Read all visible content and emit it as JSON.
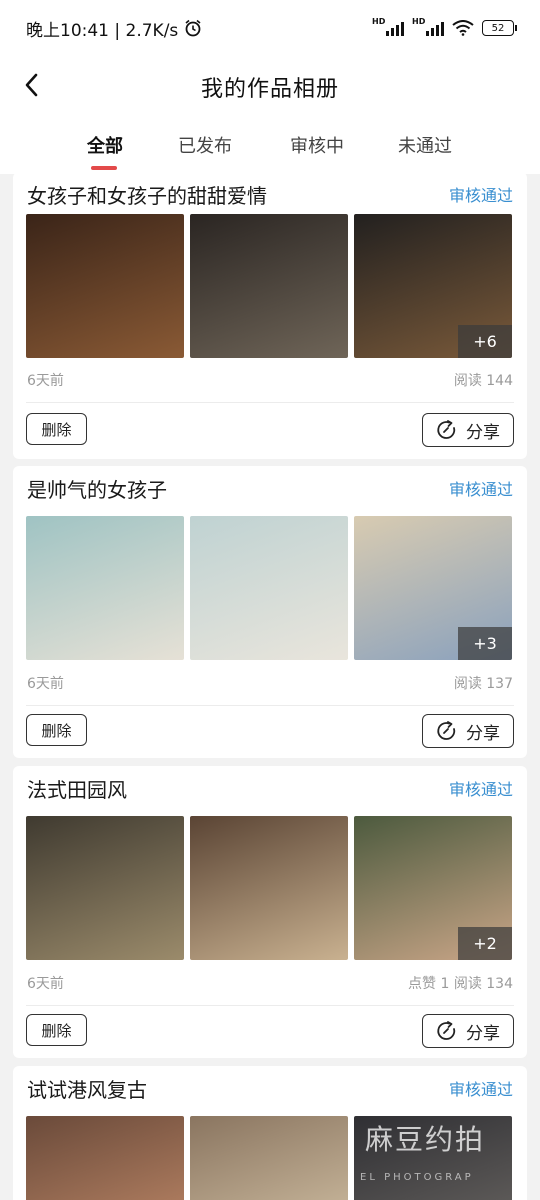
{
  "status_bar": {
    "time_speed": "晚上10:41 | 2.7K/s",
    "battery": "52",
    "signal_label": "HD",
    "icons": [
      "alarm-icon",
      "signal-icon",
      "wifi-icon",
      "battery-icon"
    ]
  },
  "header": {
    "title": "我的作品相册",
    "back_icon": "chevron-left-icon"
  },
  "tabs": [
    {
      "label": "全部",
      "active": true
    },
    {
      "label": "已发布",
      "active": false
    },
    {
      "label": "审核中",
      "active": false
    },
    {
      "label": "未通过",
      "active": false
    }
  ],
  "colors": {
    "accent": "#e34a4a",
    "status_link": "#3a8fd0",
    "page_bg": "#f2f2f2"
  },
  "albums": [
    {
      "title": "女孩子和女孩子的甜甜爱情",
      "status": "审核通过",
      "more_count": "+6",
      "time": "6天前",
      "stats": "阅读 144",
      "delete_label": "删除",
      "share_label": "分享",
      "thumb_colors": [
        [
          "#3a2418",
          "#8a5a35"
        ],
        [
          "#2a2522",
          "#6f6558"
        ],
        [
          "#22201f",
          "#7a5a3a"
        ]
      ]
    },
    {
      "title": "是帅气的女孩子",
      "status": "审核通过",
      "more_count": "+3",
      "time": "6天前",
      "stats": "阅读 137",
      "delete_label": "删除",
      "share_label": "分享",
      "thumb_colors": [
        [
          "#9fc3c3",
          "#e6e1d6"
        ],
        [
          "#bfd2d2",
          "#e9e5dc"
        ],
        [
          "#d8cbb1",
          "#8aa1bd"
        ]
      ]
    },
    {
      "title": "法式田园风",
      "status": "审核通过",
      "more_count": "+2",
      "time": "6天前",
      "stats": "点赞 1  阅读 134",
      "delete_label": "删除",
      "share_label": "分享",
      "thumb_colors": [
        [
          "#3f3a30",
          "#9b8b6b"
        ],
        [
          "#5a4434",
          "#c9b190"
        ],
        [
          "#4c5a3e",
          "#caa688"
        ]
      ]
    },
    {
      "title": "试试港风复古",
      "status": "审核通过",
      "thumb_colors": [
        [
          "#6a4a3a",
          "#c58d6b"
        ],
        [
          "#8a7560",
          "#d8c7aa"
        ],
        [
          "#2f2f33",
          "#6e6a66"
        ]
      ]
    }
  ],
  "watermark": {
    "text": "麻豆约拍",
    "sub": "EL PHOTOGRAP"
  }
}
